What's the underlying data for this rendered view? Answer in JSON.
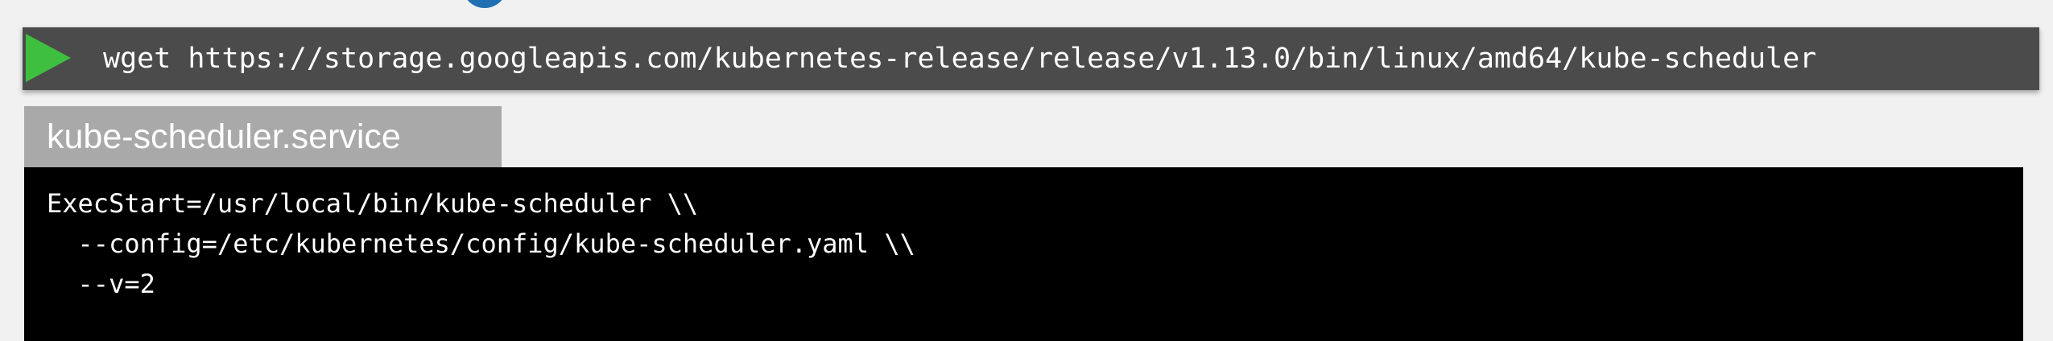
{
  "command_bar": {
    "icon": "play-icon",
    "text": "wget https://storage.googleapis.com/kubernetes-release/release/v1.13.0/bin/linux/amd64/kube-scheduler"
  },
  "file": {
    "name": "kube-scheduler.service",
    "lines": [
      "ExecStart=/usr/local/bin/kube-scheduler \\\\",
      "  --config=/etc/kubernetes/config/kube-scheduler.yaml \\\\",
      "  --v=2"
    ]
  },
  "colors": {
    "command_bar_bg": "#4b4b4b",
    "play_icon": "#3fbf3f",
    "tab_bg": "#a9a9a9",
    "code_bg": "#000000",
    "page_bg": "#f1f1f1",
    "top_circle": "#1f6fb2"
  }
}
